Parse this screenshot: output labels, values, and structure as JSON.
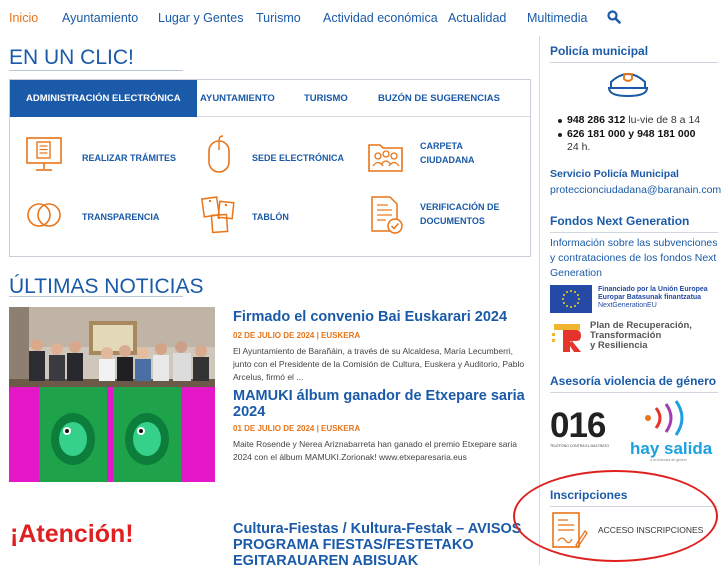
{
  "nav": {
    "items": [
      "Inicio",
      "Ayuntamiento",
      "Lugar y Gentes",
      "Turismo",
      "Actividad económica",
      "Actualidad",
      "Multimedia"
    ],
    "active_index": 0,
    "search_icon": "search-icon"
  },
  "clic": {
    "title": "EN UN CLIC!",
    "tabs": [
      "ADMINISTRACIÓN ELECTRÓNICA",
      "AYUNTAMIENTO",
      "TURISMO",
      "BUZÓN DE SUGERENCIAS"
    ],
    "active_tab": 0,
    "shortcuts": [
      {
        "label": "REALIZAR TRÁMITES",
        "icon": "monitor-document-icon"
      },
      {
        "label": "SEDE ELECTRÓNICA",
        "icon": "mouse-icon"
      },
      {
        "label": "CARPETA\nCIUDADANA",
        "icon": "group-folder-icon"
      },
      {
        "label": "TRANSPARENCIA",
        "icon": "overlapping-circles-icon"
      },
      {
        "label": "TABLÓN",
        "icon": "notice-board-icon"
      },
      {
        "label": "VERIFICACIÓN DE\nDOCUMENTOS",
        "icon": "document-check-icon"
      }
    ],
    "accent_color": "#e8751a",
    "brand_color": "#1a5aa8"
  },
  "news": {
    "title": "ÚLTIMAS NOTICIAS",
    "items": [
      {
        "title": "Firmado el convenio Bai Euskarari 2024",
        "meta": "02 DE JULIO DE 2024 | EUSKERA",
        "text": "El Ayuntamiento de Barañáin, a través de su Alcaldesa, María Lecumberri, junto con el Presidente de la Comisión de Cultura, Euskera y Auditorio, Pablo Arcelus, firmó el ..."
      },
      {
        "title": "MAMUKI álbum ganador de Etxepare saria 2024",
        "meta": "01 DE JULIO DE 2024 | EUSKERA",
        "text": "Maite Rosende y Nerea Ariznabarreta han ganado el premio Etxepare saria 2024 con el álbum MAMUKI.Zorionak! www.etxeparesaria.eus"
      },
      {
        "title": "Cultura-Fiestas / Kultura-Festak – AVISOS PROGRAMA FIESTAS/FESTETAKO EGITARAUAREN ABISUAK",
        "meta": "",
        "text": ""
      }
    ],
    "atencion": "¡Atención!"
  },
  "sidebar": {
    "policia": {
      "title": "Policía municipal",
      "phone1": "948 286 312",
      "phone1_hours": " lu-vie de 8 a 14",
      "phone2": "626 181 000 y 948 181 000",
      "phone2_hours": "24 h.",
      "servicio_title": "Servicio Policía Municipal",
      "email": "proteccionciudadana@baranain.com"
    },
    "fondos": {
      "title": "Fondos Next Generation",
      "text": "Información sobre las subvenciones y contrataciones de los fondos Next Generation",
      "eu_line1": "Financiado por la Unión Europea",
      "eu_line2": "Europar Batasunak finantzatua",
      "eu_line3": "NextGenerationEU",
      "plan_line1": "Plan de Recuperación,",
      "plan_line2": "Transformación",
      "plan_line3": "y Resiliencia"
    },
    "violencia": {
      "title": "Asesoría violencia de género",
      "num": "016",
      "num_sub": "TELÉFONO CONTRA EL MALTRATO",
      "hay_salida": "hay salida",
      "hay_salida_sub": "a la violencia de género"
    },
    "inscripciones": {
      "title": "Inscripciones",
      "label": "ACCESO INSCRIPCIONES"
    }
  }
}
